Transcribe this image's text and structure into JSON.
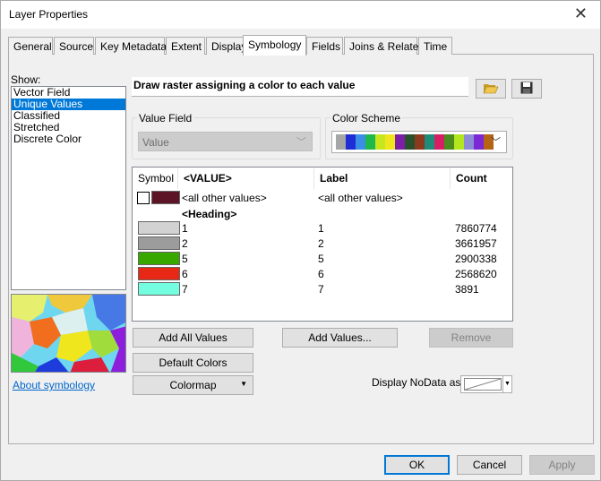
{
  "window": {
    "title": "Layer Properties"
  },
  "tabs": [
    {
      "label": "General"
    },
    {
      "label": "Source"
    },
    {
      "label": "Key Metadata"
    },
    {
      "label": "Extent"
    },
    {
      "label": "Display"
    },
    {
      "label": "Symbology"
    },
    {
      "label": "Fields"
    },
    {
      "label": "Joins & Relates"
    },
    {
      "label": "Time"
    }
  ],
  "show": {
    "label": "Show:",
    "items": [
      "Vector Field",
      "Unique Values",
      "Classified",
      "Stretched",
      "Discrete Color"
    ],
    "selected": "Unique Values"
  },
  "about_link": "About symbology",
  "description": "Draw raster assigning a color to each value",
  "value_field": {
    "title": "Value Field",
    "value": "Value"
  },
  "color_scheme": {
    "title": "Color Scheme",
    "colors": [
      "#a6a6a6",
      "#1f2dd6",
      "#3a8ee6",
      "#1fb84a",
      "#c8e61e",
      "#f0e61e",
      "#7c1fa6",
      "#28502a",
      "#8c3a1e",
      "#1e8c78",
      "#d61e64",
      "#4a8c1e",
      "#b4e61e",
      "#8c8cd6",
      "#7c28d6",
      "#b46414"
    ]
  },
  "table": {
    "headers": {
      "symbol": "Symbol",
      "value": "<VALUE>",
      "label": "Label",
      "count": "Count"
    },
    "other_values": {
      "value": "<all other values>",
      "label": "<all other values>",
      "color": "#5c1426"
    },
    "heading": "<Heading>",
    "rows": [
      {
        "value": "1",
        "label": "1",
        "count": "7860774",
        "color": "#d2d2d2"
      },
      {
        "value": "2",
        "label": "2",
        "count": "3661957",
        "color": "#9c9c9c"
      },
      {
        "value": "5",
        "label": "5",
        "count": "2900338",
        "color": "#38a800"
      },
      {
        "value": "6",
        "label": "6",
        "count": "2568620",
        "color": "#e62814"
      },
      {
        "value": "7",
        "label": "7",
        "count": "3891",
        "color": "#73ffdf"
      }
    ]
  },
  "buttons": {
    "add_all": "Add All Values",
    "add_values": "Add Values...",
    "remove": "Remove",
    "default_colors": "Default Colors",
    "colormap": "Colormap",
    "nodata_label": "Display NoData as",
    "ok": "OK",
    "cancel": "Cancel",
    "apply": "Apply"
  }
}
